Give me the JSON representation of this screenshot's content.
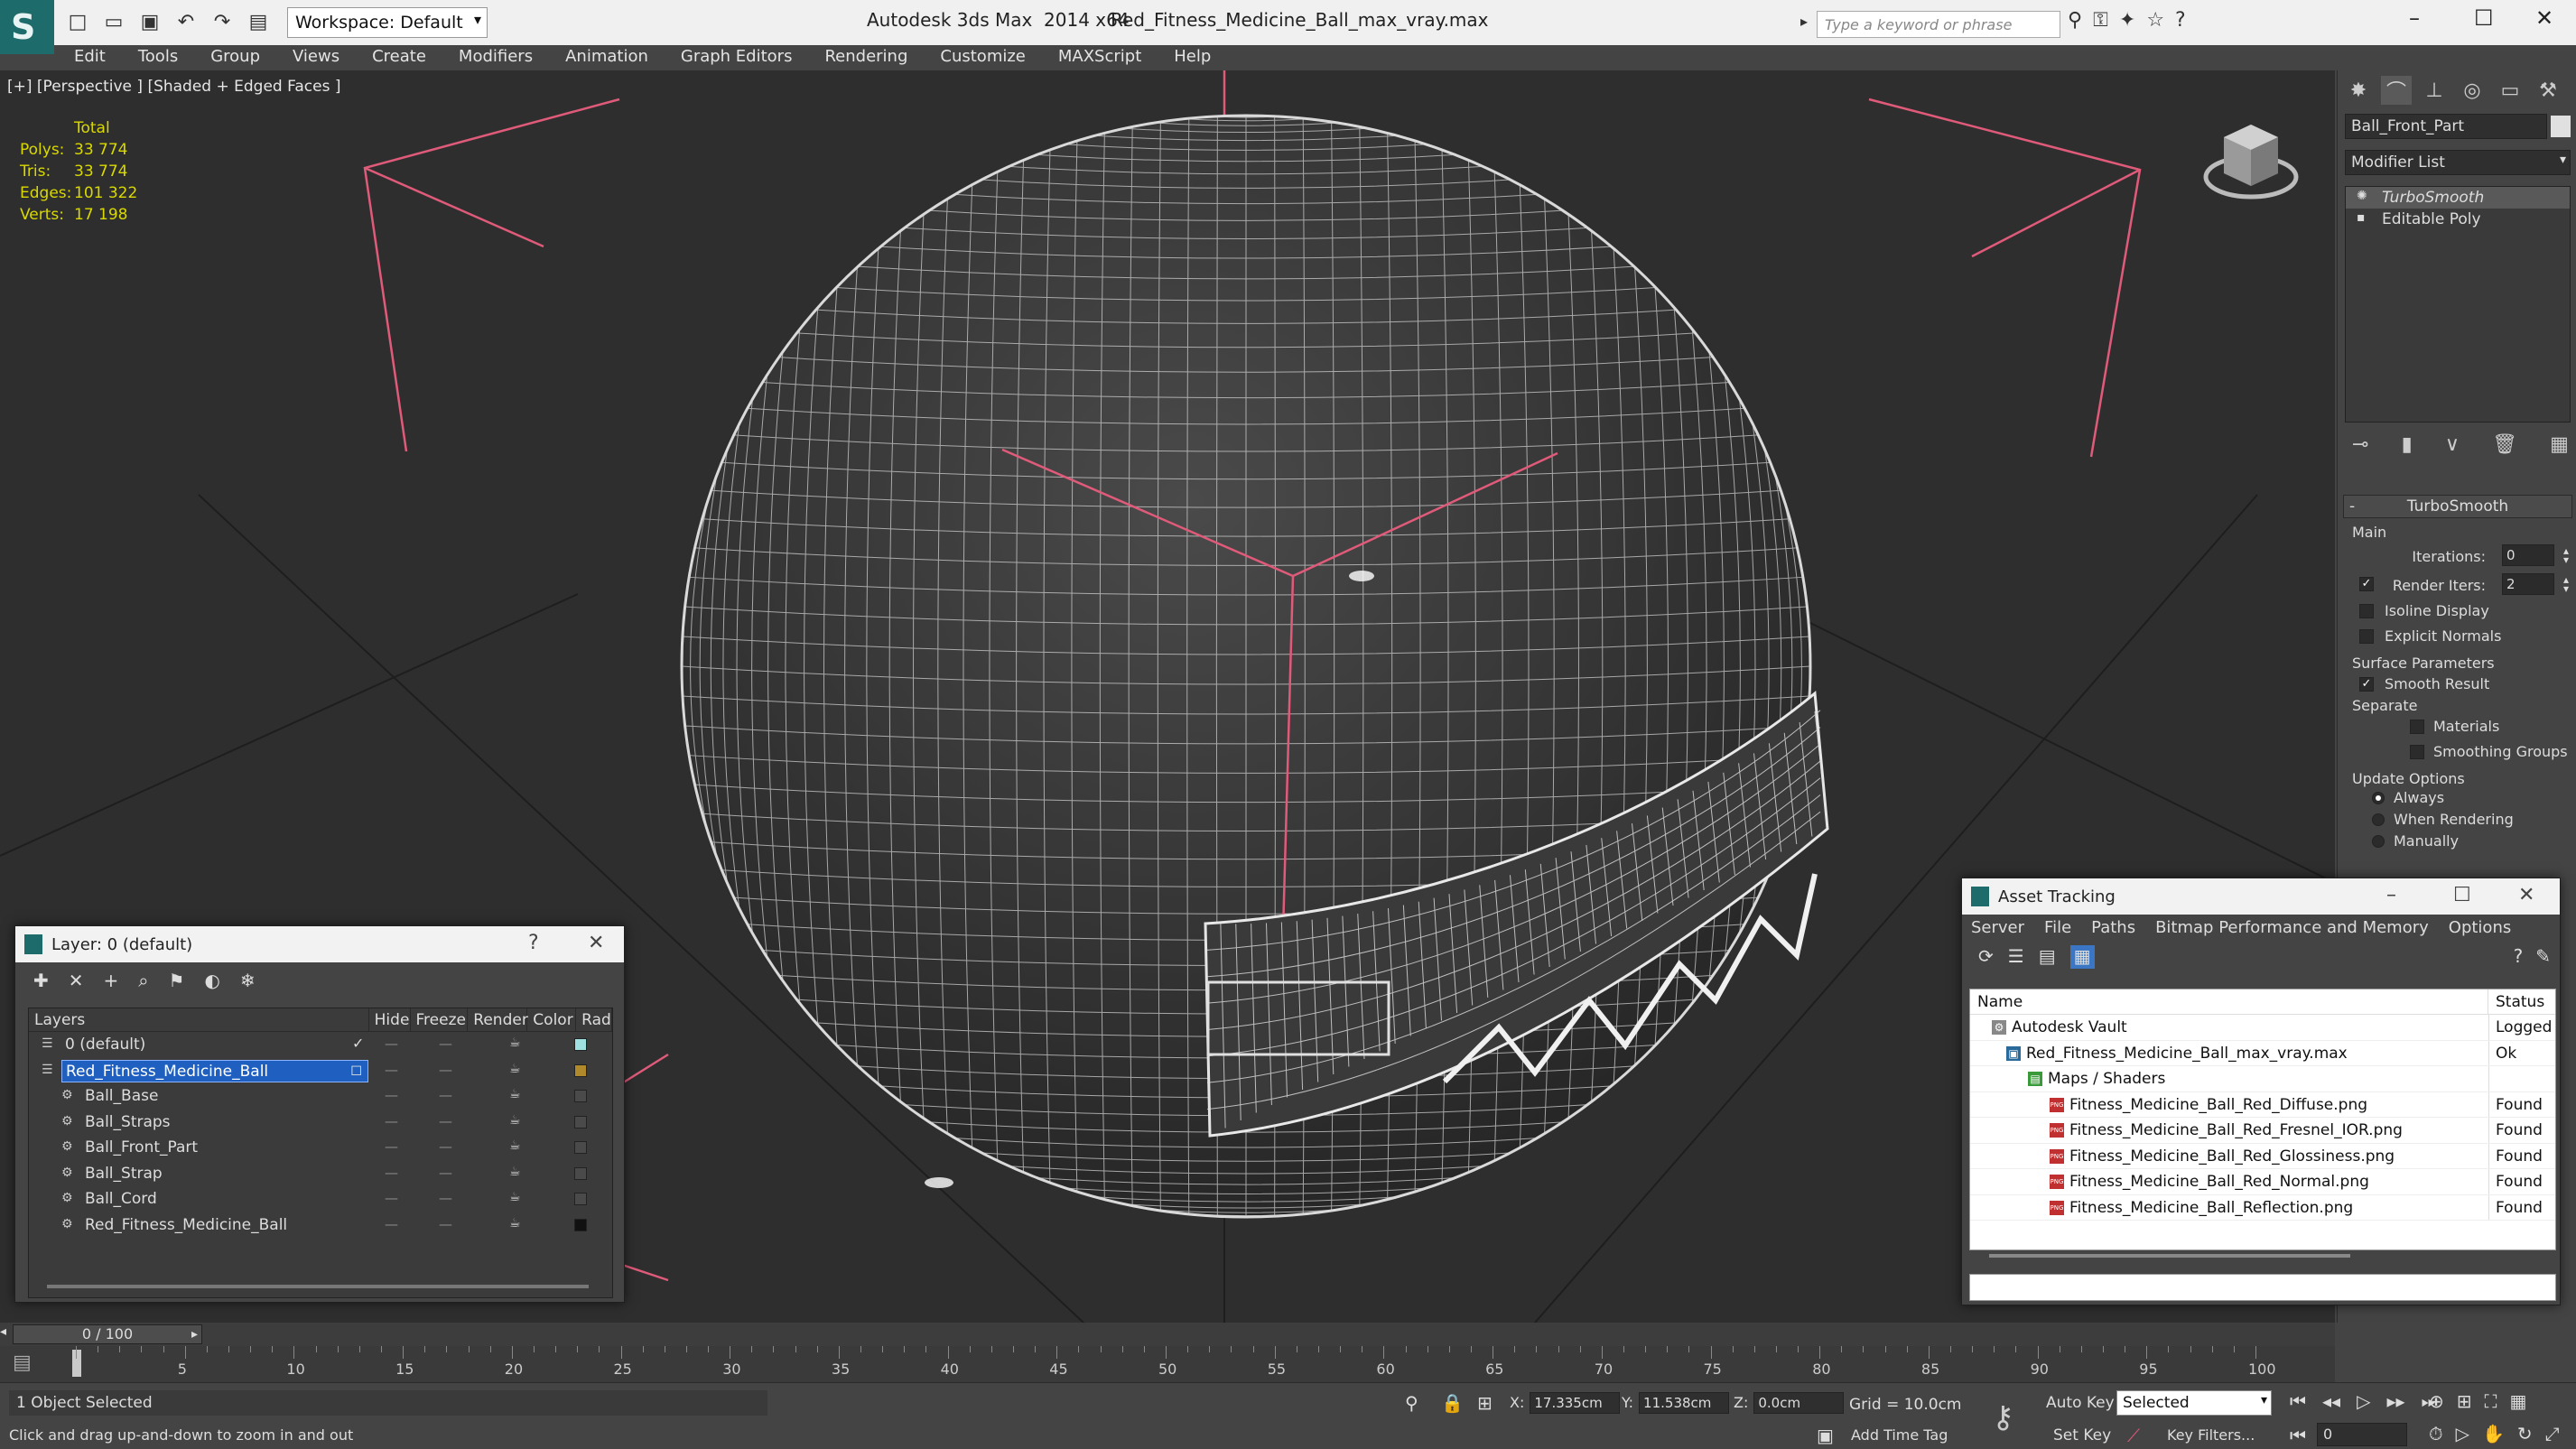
{
  "window": {
    "app_title": "Autodesk 3ds Max  2014 x64",
    "file_title": "Red_Fitness_Medicine_Ball_max_vray.max",
    "workspace_label": "Workspace: Default",
    "search_placeholder": "Type a keyword or phrase"
  },
  "menu": [
    "Edit",
    "Tools",
    "Group",
    "Views",
    "Create",
    "Modifiers",
    "Animation",
    "Graph Editors",
    "Rendering",
    "Customize",
    "MAXScript",
    "Help"
  ],
  "viewport": {
    "label": "[+] [Perspective ] [Shaded + Edged Faces ]",
    "stats_header": "Total",
    "stats": [
      {
        "key": "Polys:",
        "value": "33 774"
      },
      {
        "key": "Tris:",
        "value": "33 774"
      },
      {
        "key": "Edges:",
        "value": "101 322"
      },
      {
        "key": "Verts:",
        "value": "17 198"
      }
    ],
    "wire_color": "#d9d9d9",
    "bbox_color": "#e05a7a"
  },
  "command_panel": {
    "object_name": "Ball_Front_Part",
    "modifier_list": "Modifier List",
    "stack": [
      "TurboSmooth",
      "Editable Poly"
    ],
    "rollout_title": "TurboSmooth",
    "main_label": "Main",
    "iterations_label": "Iterations:",
    "iterations_value": "0",
    "render_iters_label": "Render Iters:",
    "render_iters_value": "2",
    "isoline_label": "Isoline Display",
    "explicit_normals_label": "Explicit Normals",
    "surface_params_label": "Surface Parameters",
    "smooth_result_label": "Smooth Result",
    "separate_label": "Separate",
    "materials_label": "Materials",
    "smoothing_groups_label": "Smoothing Groups",
    "update_options_label": "Update Options",
    "always_label": "Always",
    "when_rendering_label": "When Rendering",
    "manually_label": "Manually"
  },
  "layer_window": {
    "title": "Layer: 0 (default)",
    "help": "?",
    "close": "✕",
    "columns": [
      "Layers",
      "Hide",
      "Freeze",
      "Render",
      "Color",
      "Rad"
    ],
    "rows": [
      {
        "name": "0 (default)",
        "color": "#9fe0e0"
      },
      {
        "name": "Red_Fitness_Medicine_Ball",
        "color": "#b08a2a"
      },
      {
        "name": "Ball_Base",
        "color": "#4a4a4a"
      },
      {
        "name": "Ball_Straps",
        "color": "#4a4a4a"
      },
      {
        "name": "Ball_Front_Part",
        "color": "#4a4a4a"
      },
      {
        "name": "Ball_Strap",
        "color": "#4a4a4a"
      },
      {
        "name": "Ball_Cord",
        "color": "#4a4a4a"
      },
      {
        "name": "Red_Fitness_Medicine_Ball",
        "color": "#111111"
      }
    ]
  },
  "asset_window": {
    "title": "Asset Tracking",
    "menu": [
      "Server",
      "File",
      "Paths",
      "Bitmap Performance and Memory",
      "Options"
    ],
    "col_name": "Name",
    "col_status": "Status",
    "rows": [
      {
        "name": "Autodesk Vault",
        "status": "Logged"
      },
      {
        "name": "Red_Fitness_Medicine_Ball_max_vray.max",
        "status": "Ok"
      },
      {
        "name": "Maps / Shaders",
        "status": ""
      },
      {
        "name": "Fitness_Medicine_Ball_Red_Diffuse.png",
        "status": "Found"
      },
      {
        "name": "Fitness_Medicine_Ball_Red_Fresnel_IOR.png",
        "status": "Found"
      },
      {
        "name": "Fitness_Medicine_Ball_Red_Glossiness.png",
        "status": "Found"
      },
      {
        "name": "Fitness_Medicine_Ball_Red_Normal.png",
        "status": "Found"
      },
      {
        "name": "Fitness_Medicine_Ball_Reflection.png",
        "status": "Found"
      }
    ]
  },
  "timeline": {
    "frame_label": "0 / 100",
    "ticks": [
      "5",
      "10",
      "15",
      "20",
      "25",
      "30",
      "35",
      "40",
      "45",
      "50",
      "55",
      "60",
      "65",
      "70",
      "75",
      "80",
      "85",
      "90",
      "95",
      "100"
    ]
  },
  "status": {
    "selection": "1 Object Selected",
    "prompt": "Click and drag up-and-down to zoom in and out",
    "x_label": "X:",
    "x_value": "17.335cm",
    "y_label": "Y:",
    "y_value": "11.538cm",
    "z_label": "Z:",
    "z_value": "0.0cm",
    "grid": "Grid = 10.0cm",
    "add_time_tag": "Add Time Tag",
    "auto_key": "Auto Key",
    "set_key": "Set Key",
    "selected": "Selected",
    "key_filters": "Key Filters...",
    "frame": "0"
  }
}
